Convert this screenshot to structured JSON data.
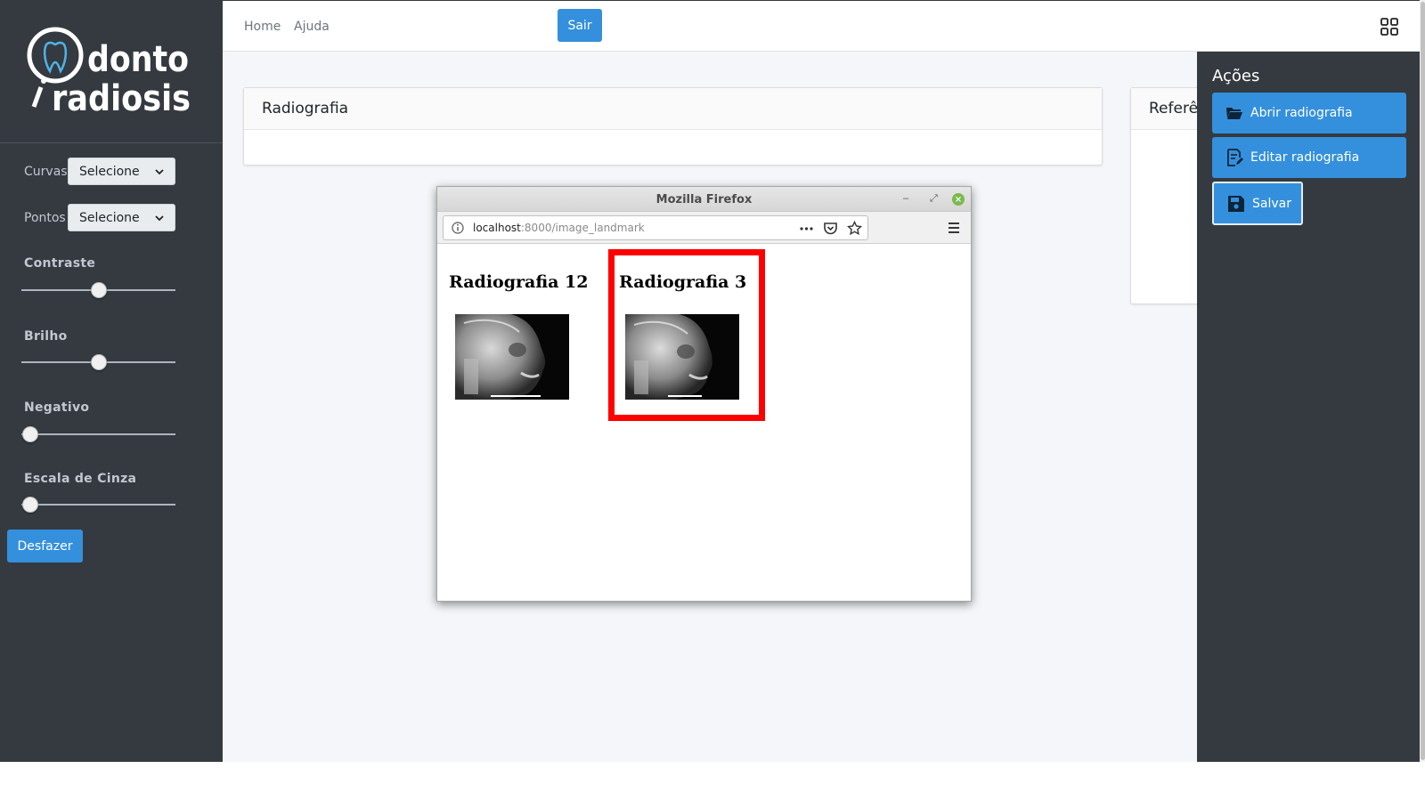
{
  "sidebar": {
    "logo_text": [
      "donto",
      "radiosis"
    ],
    "selects": [
      {
        "label": "Curvas",
        "value": "Selecione"
      },
      {
        "label": "Pontos",
        "value": "Selecione"
      }
    ],
    "sliders": [
      {
        "label": "Contraste",
        "level": 0.5
      },
      {
        "label": "Brilho",
        "level": 0.5
      },
      {
        "label": "Negativo",
        "level": 0
      },
      {
        "label": "Escala de Cinza",
        "level": 0
      }
    ],
    "undo_label": "Desfazer"
  },
  "navbar": {
    "links": [
      "Home",
      "Ajuda"
    ],
    "logout_label": "Sair",
    "grid_icon": "grid-icon"
  },
  "cards": {
    "radiografia_title": "Radiografia",
    "referencia_title": "Referê"
  },
  "control": {
    "title": "Ações",
    "actions": [
      {
        "label": "Abrir radiografia",
        "icon": "folder-open-icon"
      },
      {
        "label": "Editar radiografia",
        "icon": "edit-document-icon"
      },
      {
        "label": "Salvar",
        "icon": "save-icon"
      }
    ]
  },
  "firefox": {
    "window_title": "Mozilla Firefox",
    "url_host": "localhost",
    "url_path": ":8000/image_landmark",
    "items": [
      {
        "title": "Radiografia 12"
      },
      {
        "title": "Radiografia 3",
        "highlighted": true
      }
    ]
  },
  "colors": {
    "sidebar_bg": "#343a40",
    "primary": "#3490dc",
    "highlight": "#ff0000",
    "content_bg": "#f4f6f9"
  }
}
